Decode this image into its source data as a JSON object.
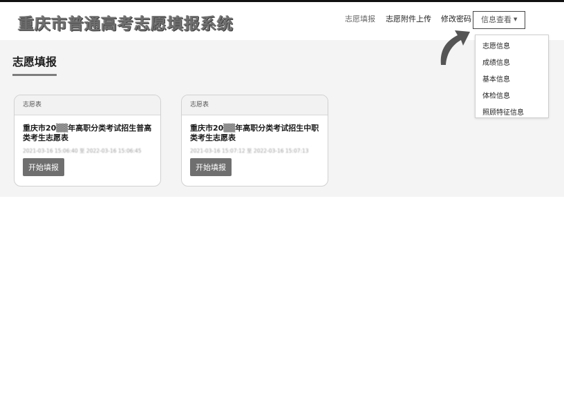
{
  "header": {
    "app_title": "重庆市普通高考志愿填报系统",
    "nav": [
      "志愿填报",
      "志愿附件上传",
      "修改密码"
    ],
    "dropdown_label": "信息查看"
  },
  "dropdown_menu": [
    "志愿信息",
    "成绩信息",
    "基本信息",
    "体检信息",
    "照顾特征信息"
  ],
  "page_title": "志愿填报",
  "cards": [
    {
      "header": "志愿表",
      "title": "重庆市20▒▒年高职分类考试招生普高类考生志愿表",
      "dates": "2021-03-16 15:06:40 至 2022-03-16 15:06:45",
      "button": "开始填报"
    },
    {
      "header": "志愿表",
      "title": "重庆市20▒▒年高职分类考试招生中职类考生志愿表",
      "dates": "2021-03-16 15:07:12 至 2022-03-16 15:07:13",
      "button": "开始填报"
    }
  ],
  "colors": {
    "content_bg": "#f4f4f4",
    "button_bg": "#6f6f6f",
    "title_text": "#6f6f6f",
    "arrow": "#555555"
  }
}
